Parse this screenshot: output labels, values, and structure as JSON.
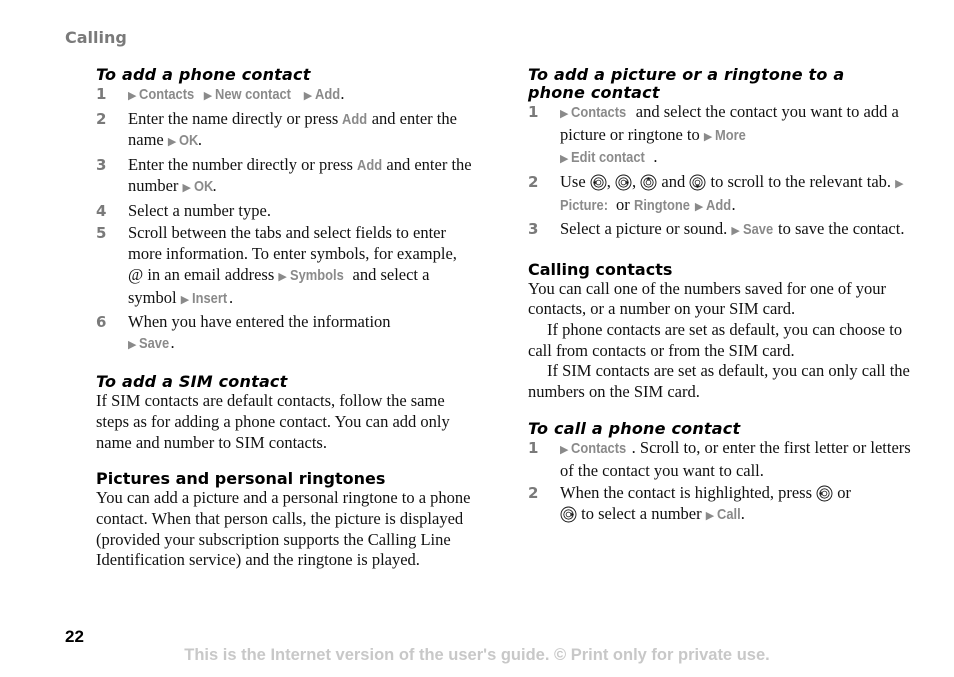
{
  "header": {
    "section": "Calling"
  },
  "left": {
    "phone_contact": {
      "title": "To add a phone contact",
      "steps": [
        {
          "n": "1",
          "ui1": "Contacts",
          "ui2": "New contact",
          "ui3": "Add",
          "end": "."
        },
        {
          "n": "2",
          "t1": "Enter the name directly or press ",
          "ui1": "Add",
          "t2": " and enter the name ",
          "ui2": "OK",
          "end": "."
        },
        {
          "n": "3",
          "t1": "Enter the number directly or press ",
          "ui1": "Add",
          "t2": " and enter the number ",
          "ui2": "OK",
          "end": "."
        },
        {
          "n": "4",
          "t1": "Select a number type."
        },
        {
          "n": "5",
          "t1": "Scroll between the tabs and select fields to enter more information. To enter symbols, for example, @ in an email address ",
          "ui1": "Symbols",
          "t2": " and select a symbol ",
          "ui2": "Insert",
          "end": "."
        },
        {
          "n": "6",
          "t1": "When you have entered the information ",
          "ui1": "Save",
          "end": "."
        }
      ]
    },
    "sim_contact": {
      "title": "To add a SIM contact",
      "body": "If SIM contacts are default contacts, follow the same steps as for adding a phone contact. You can add only name and number to SIM contacts."
    },
    "pictures": {
      "title": "Pictures and personal ringtones",
      "body": "You can add a picture and a personal ringtone to a phone contact. When that person calls, the picture is displayed (provided your subscription supports the Calling Line Identification service) and the ringtone is played."
    }
  },
  "right": {
    "add_picture": {
      "title": "To add a picture or a ringtone to a phone contact",
      "steps": [
        {
          "n": "1",
          "ui1": "Contacts",
          "t1": " and select the contact you want to add a picture or ringtone to ",
          "ui2": "More",
          "ui3": "Edit contact",
          "end": "."
        },
        {
          "n": "2",
          "t1": "Use ",
          "t2": ", ",
          "t3": ", ",
          "t4": " and ",
          "t5": " to scroll to the relevant tab. ",
          "ui1": "Picture:",
          "t6": " or ",
          "ui2": "Ringtone",
          "ui3": "Add",
          "end": ".",
          "icons": [
            "nav-left-icon",
            "nav-right-icon",
            "nav-up-icon",
            "nav-down-icon"
          ]
        },
        {
          "n": "3",
          "t1": "Select a picture or sound. ",
          "ui1": "Save",
          "t2": " to save the contact."
        }
      ]
    },
    "calling_contacts": {
      "title": "Calling contacts",
      "p1": "You can call one of the numbers saved for one of your contacts, or a number on your SIM card.",
      "p2": "If phone contacts are set as default, you can choose to call from contacts or from the SIM card.",
      "p3": "If SIM contacts are set as default, you can only call the numbers on the SIM card."
    },
    "call_phone": {
      "title": "To call a phone contact",
      "steps": [
        {
          "n": "1",
          "ui1": "Contacts",
          "t1": ". Scroll to, or enter the first letter or letters of the contact you want to call."
        },
        {
          "n": "2",
          "t1": "When the contact is highlighted, press ",
          "t2": " or ",
          "t3": " to select a number ",
          "ui1": "Call",
          "end": "."
        }
      ]
    }
  },
  "footer": {
    "page_number": "22",
    "notice": "This is the Internet version of the user's guide. © Print only for private use."
  },
  "colors": {
    "ui_gray": "#8a8a8a",
    "heading_gray": "#7a7a7a",
    "footer_gray": "#c8c8c8",
    "text": "#111111"
  }
}
